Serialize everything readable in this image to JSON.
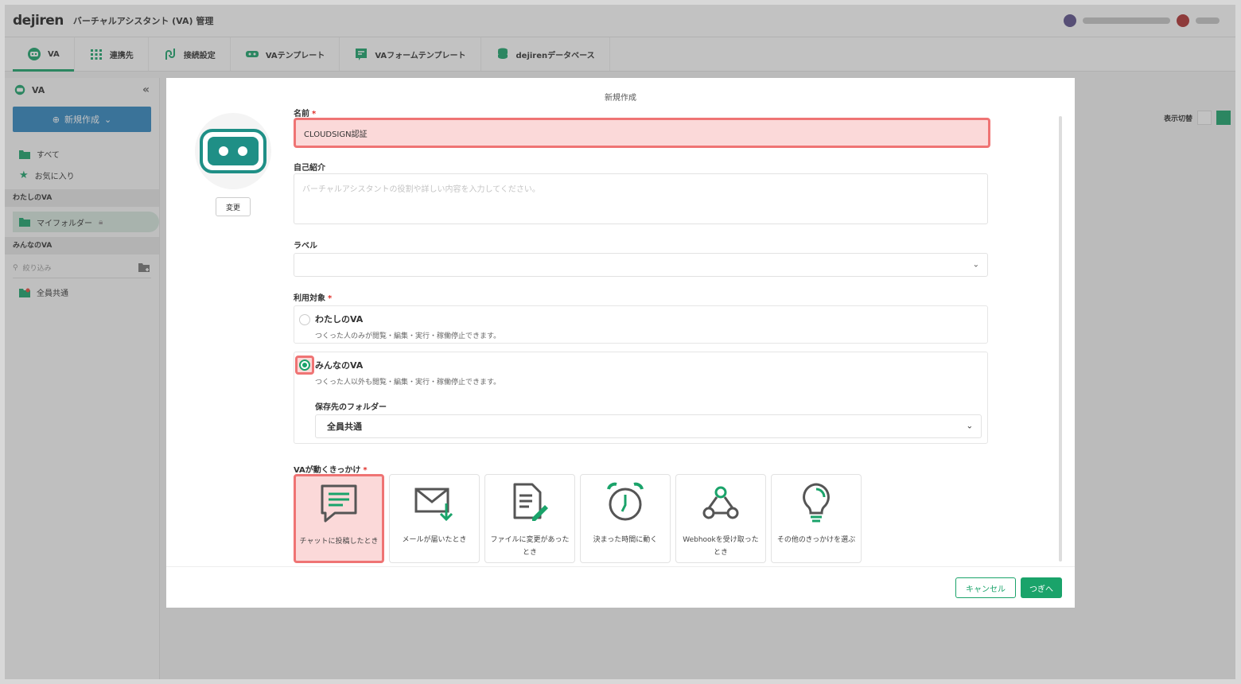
{
  "header": {
    "logo": "dejiren",
    "app_title": "バーチャルアシスタント (VA) 管理"
  },
  "nav": {
    "tabs": [
      {
        "label": "VA",
        "icon": "robot-icon"
      },
      {
        "label": "連携先",
        "icon": "grid-icon"
      },
      {
        "label": "接続設定",
        "icon": "connection-icon"
      },
      {
        "label": "VAテンプレート",
        "icon": "template-icon"
      },
      {
        "label": "VAフォームテンプレート",
        "icon": "form-icon"
      },
      {
        "label": "dejirenデータベース",
        "icon": "database-icon"
      }
    ]
  },
  "sidebar": {
    "title": "VA",
    "new_button": "新規作成",
    "items": [
      {
        "label": "すべて",
        "icon": "folder-icon"
      },
      {
        "label": "お気に入り",
        "icon": "star-icon"
      }
    ],
    "my_va_section": "わたしのVA",
    "my_folder": "マイフォルダー",
    "everyone_section": "みんなのVA",
    "search_placeholder": "絞り込み",
    "shared_folder": "全員共通"
  },
  "view_toggle_label": "表示切替",
  "modal": {
    "title": "新規作成",
    "change_button": "変更",
    "name_label": "名前",
    "name_value": "CLOUDSIGN認証",
    "intro_label": "自己紹介",
    "intro_placeholder": "バーチャルアシスタントの役割や詳しい内容を入力してください。",
    "label_label": "ラベル",
    "target_label": "利用対象",
    "targets": [
      {
        "title": "わたしのVA",
        "desc": "つくった人のみが閲覧・編集・実行・稼働停止できます。",
        "checked": false
      },
      {
        "title": "みんなのVA",
        "desc": "つくった人以外も閲覧・編集・実行・稼働停止できます。",
        "checked": true
      }
    ],
    "folder_label": "保存先のフォルダー",
    "folder_value": "全員共通",
    "trigger_label": "VAが動くきっかけ",
    "triggers": [
      {
        "label": "チャットに投稿したとき",
        "icon": "chat-icon",
        "selected": true
      },
      {
        "label": "メールが届いたとき",
        "icon": "mail-icon",
        "selected": false
      },
      {
        "label": "ファイルに変更があったとき",
        "icon": "file-edit-icon",
        "selected": false
      },
      {
        "label": "決まった時間に動く",
        "icon": "alarm-clock-icon",
        "selected": false
      },
      {
        "label": "Webhookを受け取ったとき",
        "icon": "webhook-icon",
        "selected": false
      },
      {
        "label": "その他のきっかけを選ぶ",
        "icon": "lightbulb-icon",
        "selected": false
      }
    ],
    "cancel_button": "キャンセル",
    "next_button": "つぎへ"
  },
  "colors": {
    "accent": "#1aa36a",
    "highlight_border": "#ef7474",
    "highlight_fill": "#fbd9d9",
    "primary_blue": "#2e86c1"
  }
}
